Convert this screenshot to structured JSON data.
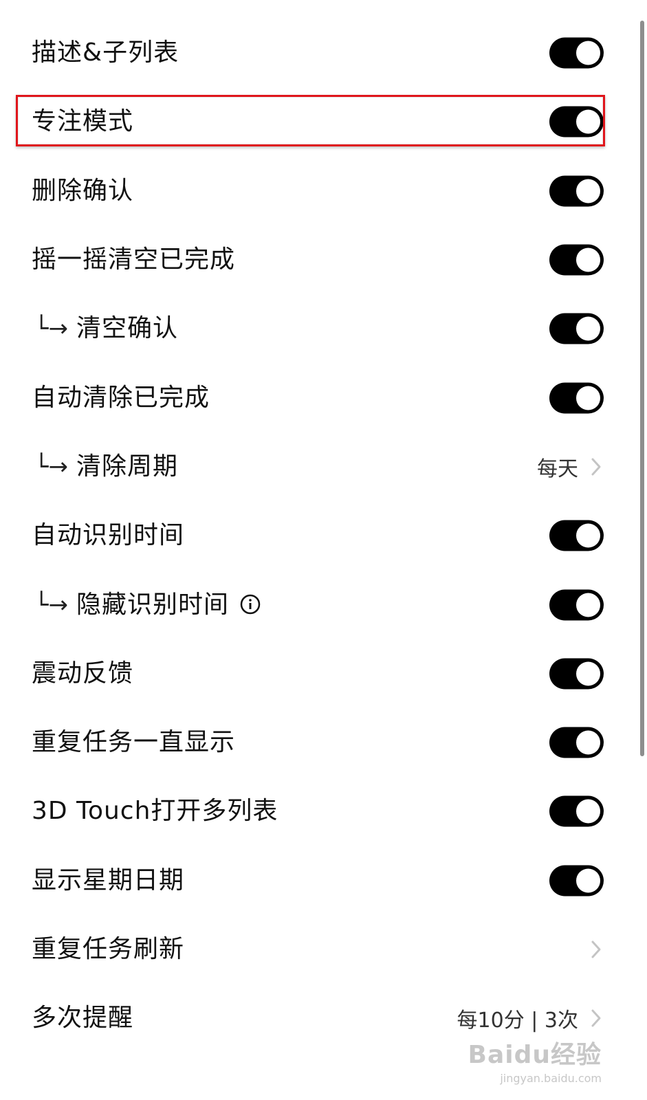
{
  "settings": [
    {
      "label": "描述&子列表",
      "control": "toggle",
      "on": true,
      "sub": false
    },
    {
      "label": "专注模式",
      "control": "toggle",
      "on": true,
      "sub": false,
      "highlighted": true
    },
    {
      "label": "删除确认",
      "control": "toggle",
      "on": true,
      "sub": false
    },
    {
      "label": "摇一摇清空已完成",
      "control": "toggle",
      "on": true,
      "sub": false
    },
    {
      "label": "清空确认",
      "control": "toggle",
      "on": true,
      "sub": true
    },
    {
      "label": "自动清除已完成",
      "control": "toggle",
      "on": true,
      "sub": false
    },
    {
      "label": "清除周期",
      "control": "disclosure",
      "value": "每天",
      "sub": true
    },
    {
      "label": "自动识别时间",
      "control": "toggle",
      "on": true,
      "sub": false
    },
    {
      "label": "隐藏识别时间",
      "control": "toggle",
      "on": true,
      "sub": true,
      "info_icon": "info-circle-icon"
    },
    {
      "label": "震动反馈",
      "control": "toggle",
      "on": true,
      "sub": false
    },
    {
      "label": "重复任务一直显示",
      "control": "toggle",
      "on": true,
      "sub": false
    },
    {
      "label": "3D Touch打开多列表",
      "control": "toggle",
      "on": true,
      "sub": false
    },
    {
      "label": "显示星期日期",
      "control": "toggle",
      "on": true,
      "sub": false
    },
    {
      "label": "重复任务刷新",
      "control": "disclosure",
      "value": "",
      "sub": false
    },
    {
      "label": "多次提醒",
      "control": "disclosure",
      "value": "每10分 | 3次",
      "sub": false
    }
  ],
  "sub_item_prefix": "└→",
  "colors": {
    "toggle_on": "#000000",
    "highlight_border": "#e0151b",
    "chevron": "#c4c4c4"
  },
  "watermark": {
    "logo": "Baidu经验",
    "url": "jingyan.baidu.com"
  }
}
